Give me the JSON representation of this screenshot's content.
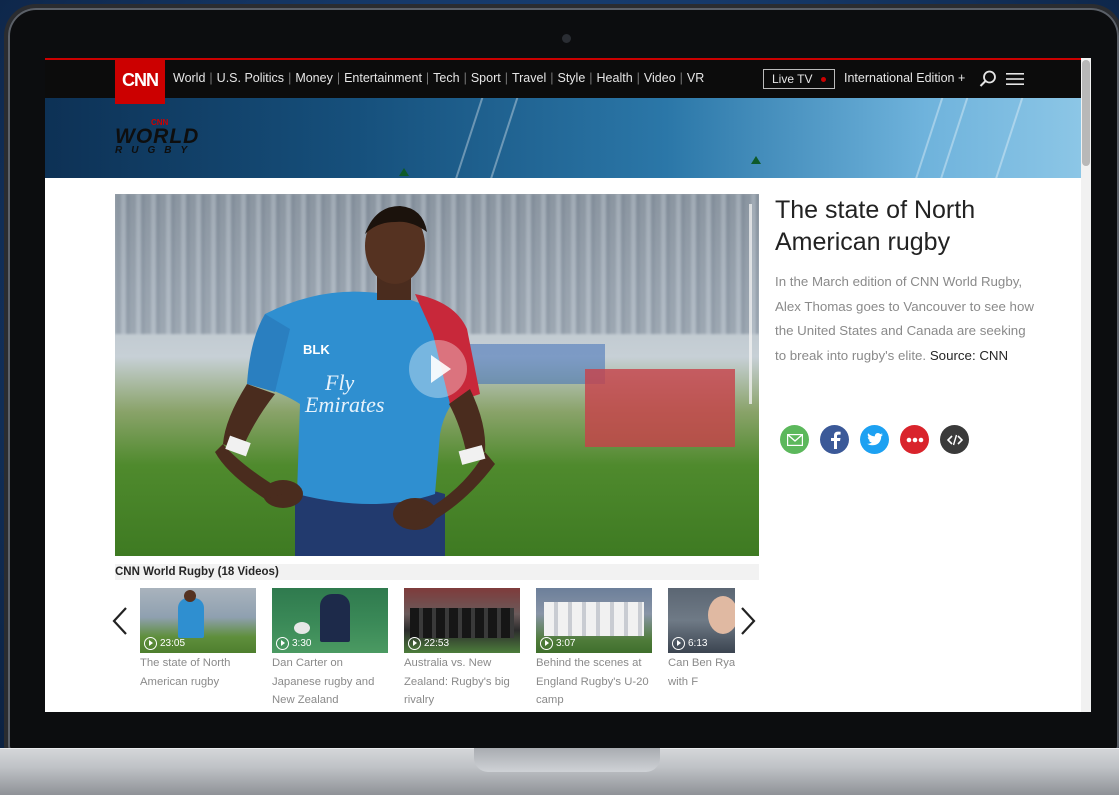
{
  "nav": {
    "logo": "CNN",
    "links": [
      "World",
      "U.S. Politics",
      "Money",
      "Entertainment",
      "Tech",
      "Sport",
      "Travel",
      "Style",
      "Health",
      "Video",
      "VR"
    ],
    "live_tv": "Live TV",
    "edition": "International Edition +"
  },
  "banner": {
    "logo_top": "CNN",
    "logo_main": "WORLD",
    "logo_sub": "RUGBY"
  },
  "article": {
    "title": "The state of North American rugby",
    "description": "In the March edition of CNN World Rugby, Alex Thomas goes to Vancouver to see how the United States and Canada are seeking to break into rugby's elite.",
    "source": "Source: CNN"
  },
  "share_icons": [
    {
      "name": "email-icon",
      "color": "#5cb85c"
    },
    {
      "name": "facebook-icon",
      "color": "#3b5998"
    },
    {
      "name": "twitter-icon",
      "color": "#1da1f2"
    },
    {
      "name": "more-icon",
      "color": "#d9242c"
    },
    {
      "name": "embed-icon",
      "color": "#3a3a3a"
    }
  ],
  "carousel": {
    "title": "CNN World Rugby (18 Videos)",
    "items": [
      {
        "duration": "23:05",
        "title": "The state of North American rugby"
      },
      {
        "duration": "3:30",
        "title": "Dan Carter on Japanese rugby and New Zealand"
      },
      {
        "duration": "22:53",
        "title": "Australia vs. New Zealand: Rugby's big rivalry"
      },
      {
        "duration": "3:07",
        "title": "Behind the scenes at England Rugby's U-20 camp"
      },
      {
        "duration": "6:13",
        "title": "Can Ben Rya magic with F"
      }
    ]
  }
}
